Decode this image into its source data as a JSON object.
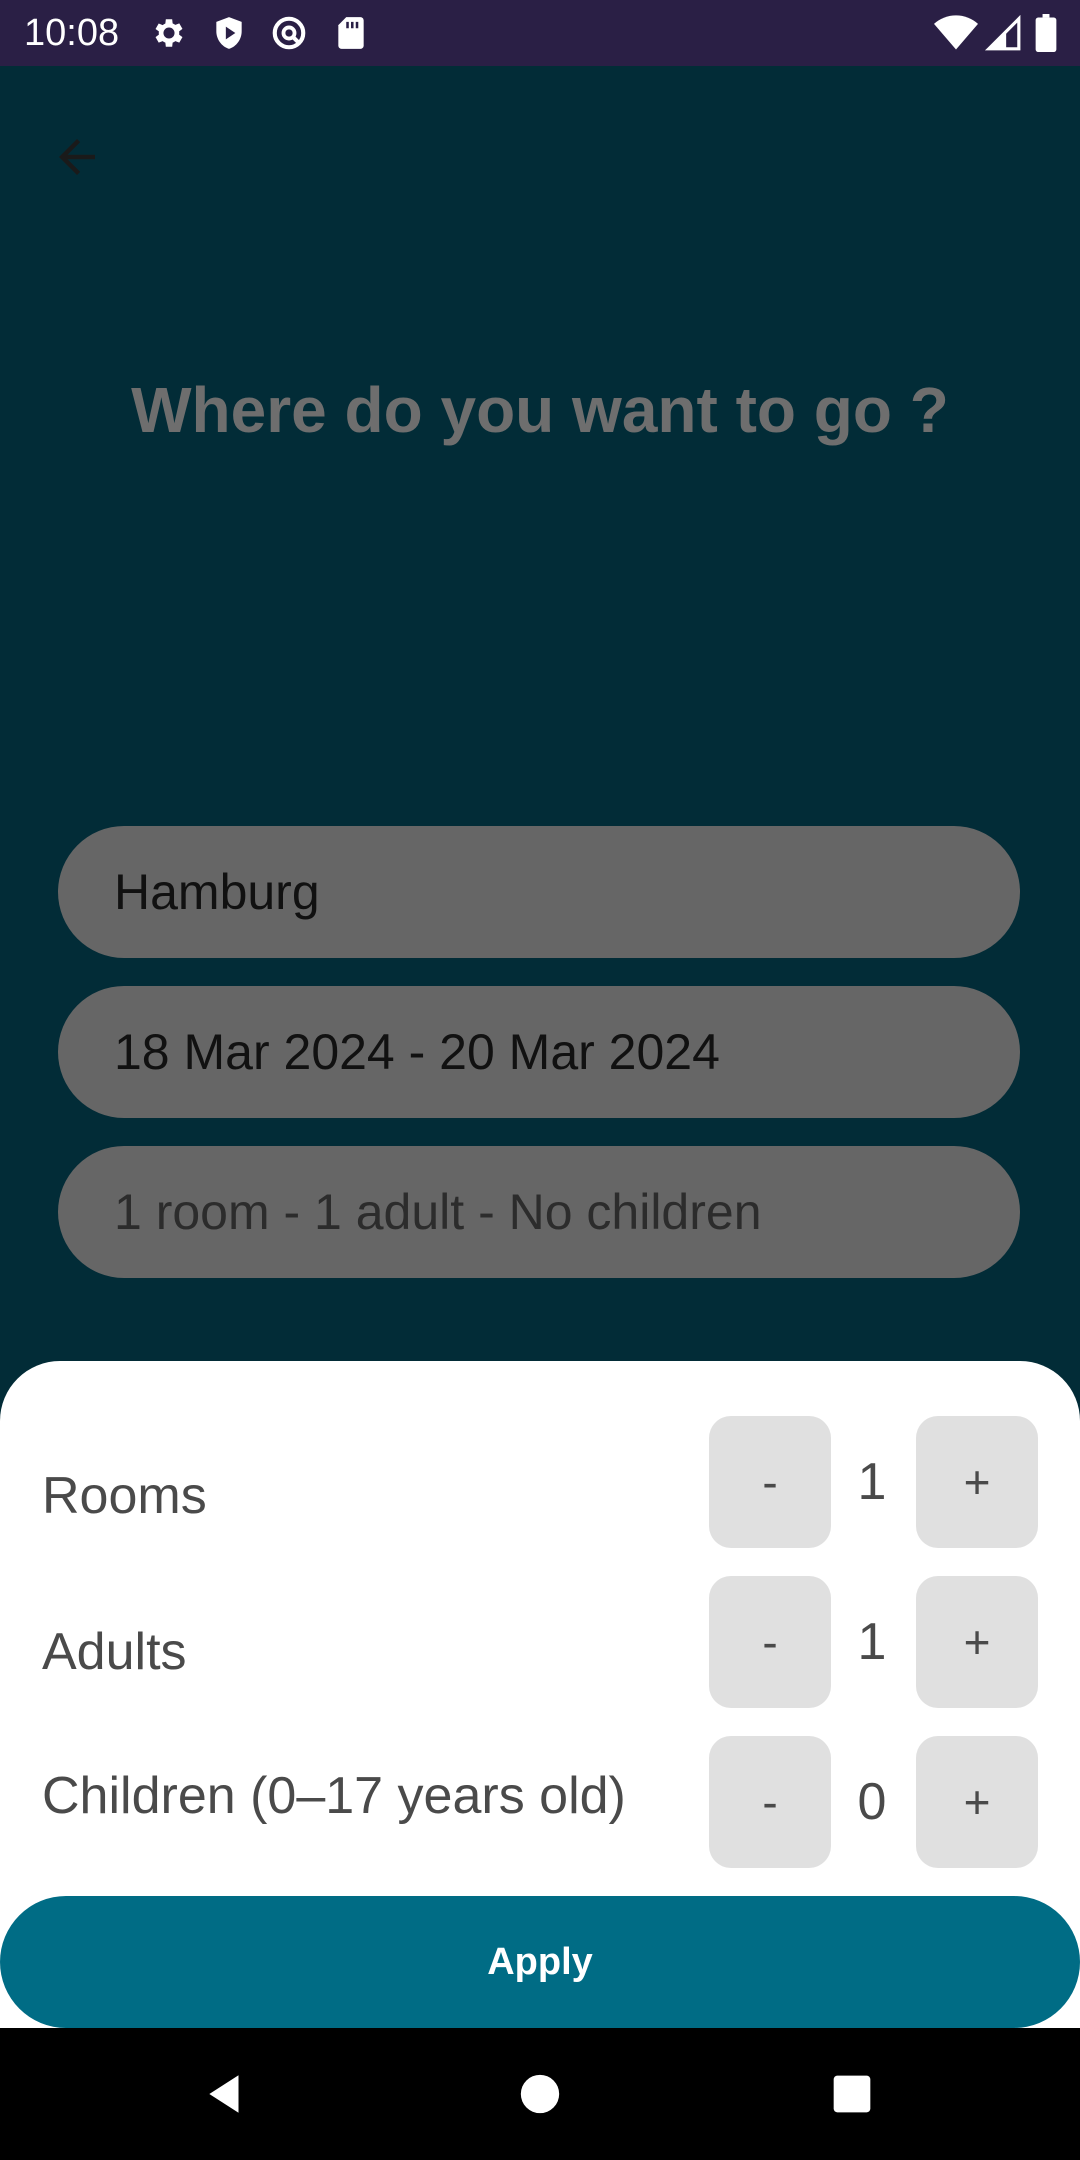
{
  "status_bar": {
    "time": "10:08",
    "left_icons": [
      "gear-icon",
      "shield-icon",
      "vpn-key-icon",
      "sd-card-icon"
    ],
    "right_icons": [
      "wifi-icon",
      "cell-signal-icon",
      "battery-icon"
    ]
  },
  "page": {
    "back_icon": "arrow-back-icon",
    "headline": "Where do you want to go ?"
  },
  "form": {
    "destination_value": "Hamburg",
    "dates_value": "18 Mar 2024 - 20 Mar 2024",
    "occupancy_value": "1 room - 1 adult - No children"
  },
  "sheet": {
    "rows": [
      {
        "label": "Rooms",
        "decrement": "-",
        "value": "1",
        "increment": "+"
      },
      {
        "label": "Adults",
        "decrement": "-",
        "value": "1",
        "increment": "+"
      },
      {
        "label": "Children (0–17 years old)",
        "decrement": "-",
        "value": "0",
        "increment": "+"
      }
    ],
    "apply_label": "Apply"
  },
  "nav_bar": {
    "buttons": [
      "back-triangle-icon",
      "home-circle-icon",
      "recents-square-icon"
    ]
  },
  "colors": {
    "background": "#022c37",
    "status_bar": "#2a1f45",
    "field": "#666666",
    "sheet": "#ffffff",
    "stepper": "#e0e0e0",
    "apply": "#006c85"
  }
}
